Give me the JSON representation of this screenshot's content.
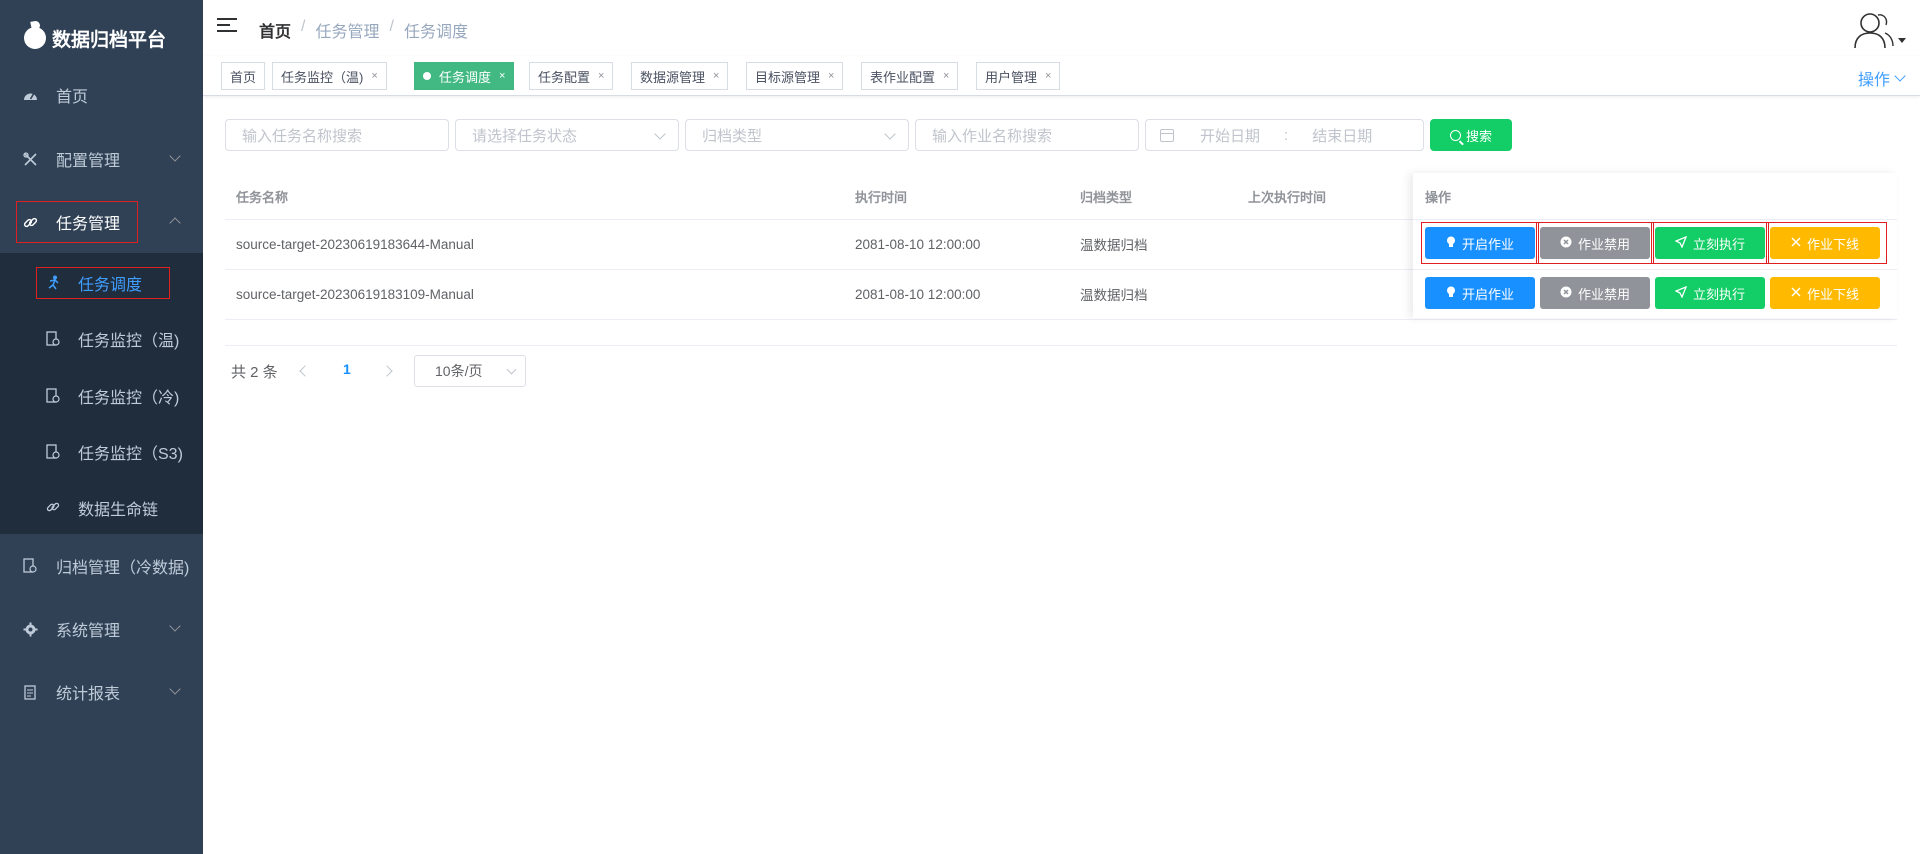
{
  "sidebar": {
    "logo": "数据归档平台",
    "items": [
      {
        "label": "首页",
        "icon": "dashboard-icon"
      },
      {
        "label": "配置管理",
        "icon": "tools-icon"
      },
      {
        "label": "任务管理",
        "icon": "link-icon"
      },
      {
        "label": "归档管理（冷数据)",
        "icon": "archive-icon"
      },
      {
        "label": "系统管理",
        "icon": "gear-icon"
      },
      {
        "label": "统计报表",
        "icon": "report-icon"
      }
    ],
    "submenu": [
      {
        "label": "任务调度",
        "icon": "running-icon"
      },
      {
        "label": "任务监控（温)",
        "icon": "monitor-icon"
      },
      {
        "label": "任务监控（冷)",
        "icon": "monitor-icon"
      },
      {
        "label": "任务监控（S3)",
        "icon": "monitor-icon"
      },
      {
        "label": "数据生命链",
        "icon": "link-icon"
      }
    ]
  },
  "navbar": {
    "breadcrumb": [
      "首页",
      "任务管理",
      "任务调度"
    ],
    "separator": "/"
  },
  "tags": [
    {
      "label": "首页",
      "closable": false,
      "active": false
    },
    {
      "label": "任务监控（温)",
      "closable": true,
      "active": false
    },
    {
      "label": "任务调度",
      "closable": true,
      "active": true
    },
    {
      "label": "任务配置",
      "closable": true,
      "active": false
    },
    {
      "label": "数据源管理",
      "closable": true,
      "active": false
    },
    {
      "label": "目标源管理",
      "closable": true,
      "active": false
    },
    {
      "label": "表作业配置",
      "closable": true,
      "active": false
    },
    {
      "label": "用户管理",
      "closable": true,
      "active": false
    }
  ],
  "tag_close_symbol": "×",
  "ops_menu_label": "操作",
  "filters": {
    "task_name_placeholder": "输入任务名称搜索",
    "task_status_placeholder": "请选择任务状态",
    "archive_type_placeholder": "归档类型",
    "job_name_placeholder": "输入作业名称搜索",
    "start_date_placeholder": "开始日期",
    "range_separator": ":",
    "end_date_placeholder": "结束日期",
    "search_label": "搜索"
  },
  "table": {
    "columns": [
      "任务名称",
      "执行时间",
      "归档类型",
      "上次执行时间",
      "操作"
    ],
    "rows": [
      {
        "name": "source-target-20230619183644-Manual",
        "exec_time": "2081-08-10 12:00:00",
        "type": "温数据归档",
        "last_exec": ""
      },
      {
        "name": "source-target-20230619183109-Manual",
        "exec_time": "2081-08-10 12:00:00",
        "type": "温数据归档",
        "last_exec": ""
      }
    ],
    "actions": {
      "start": "开启作业",
      "disable": "作业禁用",
      "run_now": "立刻执行",
      "offline": "作业下线"
    }
  },
  "pagination": {
    "total_label": "共 2 条",
    "current_page": "1",
    "page_size": "10条/页"
  },
  "colors": {
    "sidebar_bg": "#304156",
    "submenu_bg": "#1f2d3d",
    "active_tag": "#42b983",
    "primary": "#1890ff",
    "success": "#13ce66",
    "warning": "#ffba00",
    "info": "#909399",
    "highlight_box": "#e02020"
  }
}
